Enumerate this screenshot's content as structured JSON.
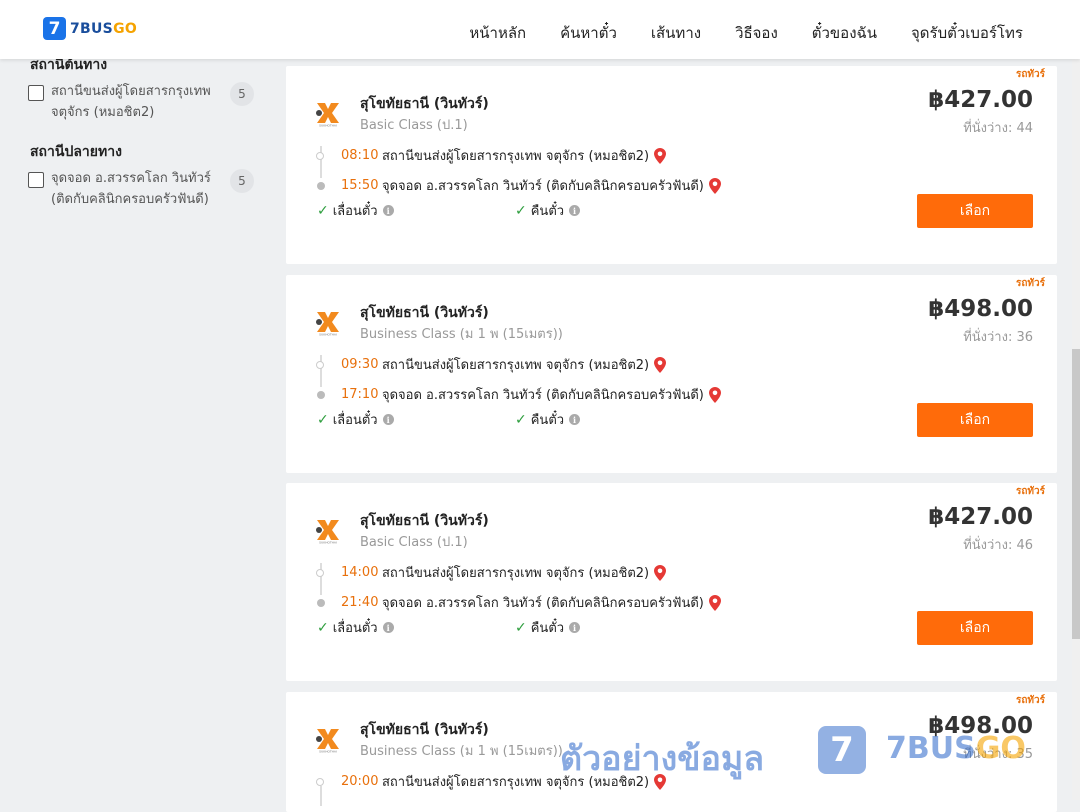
{
  "brand": {
    "number": "7",
    "name_a": "7BUS",
    "name_b": "GO"
  },
  "nav": [
    "หน้าหลัก",
    "ค้นหาตั๋ว",
    "เส้นทาง",
    "วิธีจอง",
    "ตั๋วของฉัน",
    "จุดรับตั๋วเบอร์โทร"
  ],
  "filters": {
    "origin_title": "สถานีต้นทาง",
    "origin_option": "สถานีขนส่งผู้โดยสารกรุงเทพ จตุจักร (หมอชิต2)",
    "origin_count": "5",
    "dest_title": "สถานีปลายทาง",
    "dest_option": "จุดจอด อ.สวรรคโลก วินทัวร์ (ติดกับคลินิกครอบครัวฟันดี)",
    "dest_count": "5"
  },
  "trips": [
    {
      "tag": "รถทัวร์",
      "operator": "สุโขทัยธานี (วินทัวร์)",
      "class": "Basic Class (ป.1)",
      "price": "฿427.00",
      "seats": "ที่นั่งว่าง: 44",
      "dep_time": "08:10",
      "dep_station": "สถานีขนส่งผู้โดยสารกรุงเทพ จตุจักร (หมอชิต2)",
      "arr_time": "15:50",
      "arr_station": "จุดจอด อ.สวรรคโลก วินทัวร์ (ติดกับคลินิกครอบครัวฟันดี)",
      "feat1": "เลื่อนตั๋ว",
      "feat2": "คืนตั๋ว",
      "button": "เลือก"
    },
    {
      "tag": "รถทัวร์",
      "operator": "สุโขทัยธานี (วินทัวร์)",
      "class": "Business Class (ม 1 พ (15เมตร))",
      "price": "฿498.00",
      "seats": "ที่นั่งว่าง: 36",
      "dep_time": "09:30",
      "dep_station": "สถานีขนส่งผู้โดยสารกรุงเทพ จตุจักร (หมอชิต2)",
      "arr_time": "17:10",
      "arr_station": "จุดจอด อ.สวรรคโลก วินทัวร์ (ติดกับคลินิกครอบครัวฟันดี)",
      "feat1": "เลื่อนตั๋ว",
      "feat2": "คืนตั๋ว",
      "button": "เลือก"
    },
    {
      "tag": "รถทัวร์",
      "operator": "สุโขทัยธานี (วินทัวร์)",
      "class": "Basic Class (ป.1)",
      "price": "฿427.00",
      "seats": "ที่นั่งว่าง: 46",
      "dep_time": "14:00",
      "dep_station": "สถานีขนส่งผู้โดยสารกรุงเทพ จตุจักร (หมอชิต2)",
      "arr_time": "21:40",
      "arr_station": "จุดจอด อ.สวรรคโลก วินทัวร์ (ติดกับคลินิกครอบครัวฟันดี)",
      "feat1": "เลื่อนตั๋ว",
      "feat2": "คืนตั๋ว",
      "button": "เลือก"
    },
    {
      "tag": "รถทัวร์",
      "operator": "สุโขทัยธานี (วินทัวร์)",
      "class": "Business Class (ม 1 พ (15เมตร))",
      "price": "฿498.00",
      "seats": "ที่นั่งว่าง: 35",
      "dep_time": "20:00",
      "dep_station": "สถานีขนส่งผู้โดยสารกรุงเทพ จตุจักร (หมอชิต2)"
    }
  ],
  "watermark": {
    "text": "ตัวอย่างข้อมูล",
    "logo_number": "7",
    "brand_a": "7BUS",
    "brand_b": "GO"
  },
  "colors": {
    "accent": "#ff6b0a",
    "time": "#e8700c",
    "brand_blue": "#1a73e8",
    "check": "#2e9e3e",
    "pin": "#e53935"
  }
}
